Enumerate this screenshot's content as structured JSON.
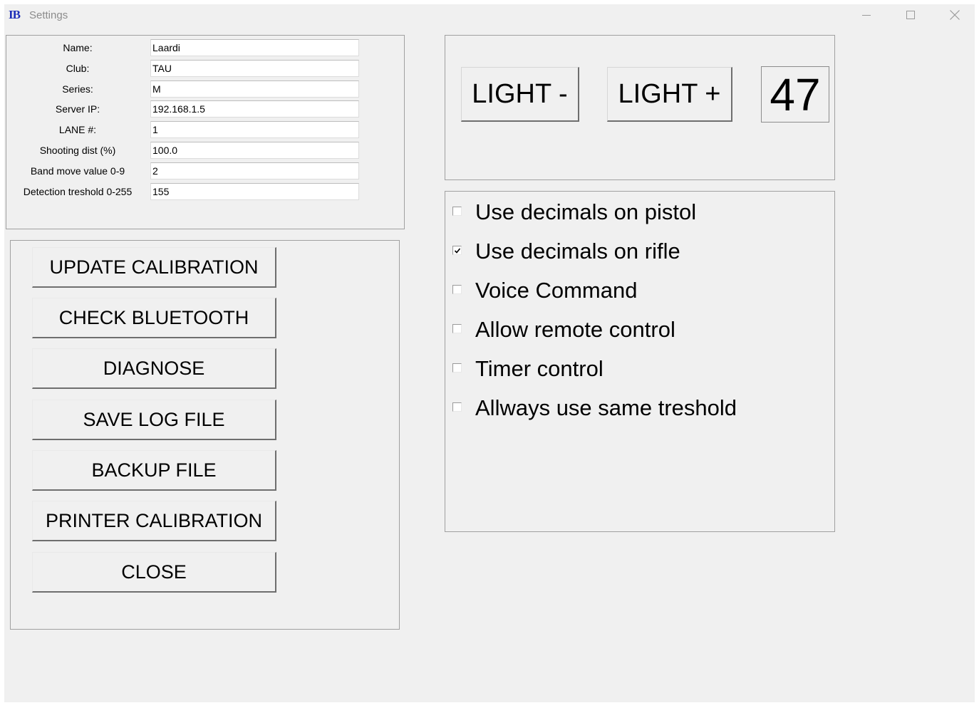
{
  "window": {
    "app_icon_text": "IB",
    "title": "Settings"
  },
  "fields": [
    {
      "label": "Name:",
      "value": "Laardi"
    },
    {
      "label": "Club:",
      "value": "TAU"
    },
    {
      "label": "Series:",
      "value": "M"
    },
    {
      "label": "Server IP:",
      "value": "192.168.1.5"
    },
    {
      "label": "LANE #:",
      "value": "1"
    },
    {
      "label": "Shooting dist (%)",
      "value": "100.0"
    },
    {
      "label": "Band move value 0-9",
      "value": "2"
    },
    {
      "label": "Detection treshold 0-255",
      "value": "155"
    }
  ],
  "actions": {
    "update_calibration": "UPDATE CALIBRATION",
    "check_bluetooth": "CHECK BLUETOOTH",
    "diagnose": "DIAGNOSE",
    "save_log_file": "SAVE LOG FILE",
    "backup_file": "BACKUP FILE",
    "printer_calibration": "PRINTER CALIBRATION",
    "close": "CLOSE"
  },
  "light": {
    "minus_label": "LIGHT -",
    "plus_label": "LIGHT +",
    "value": "47"
  },
  "options": [
    {
      "label": "Use decimals on pistol",
      "checked": false
    },
    {
      "label": "Use decimals on rifle",
      "checked": true
    },
    {
      "label": "Voice Command",
      "checked": false
    },
    {
      "label": "Allow remote control",
      "checked": false
    },
    {
      "label": "Timer control",
      "checked": false
    },
    {
      "label": "Allways use same treshold",
      "checked": false
    }
  ]
}
